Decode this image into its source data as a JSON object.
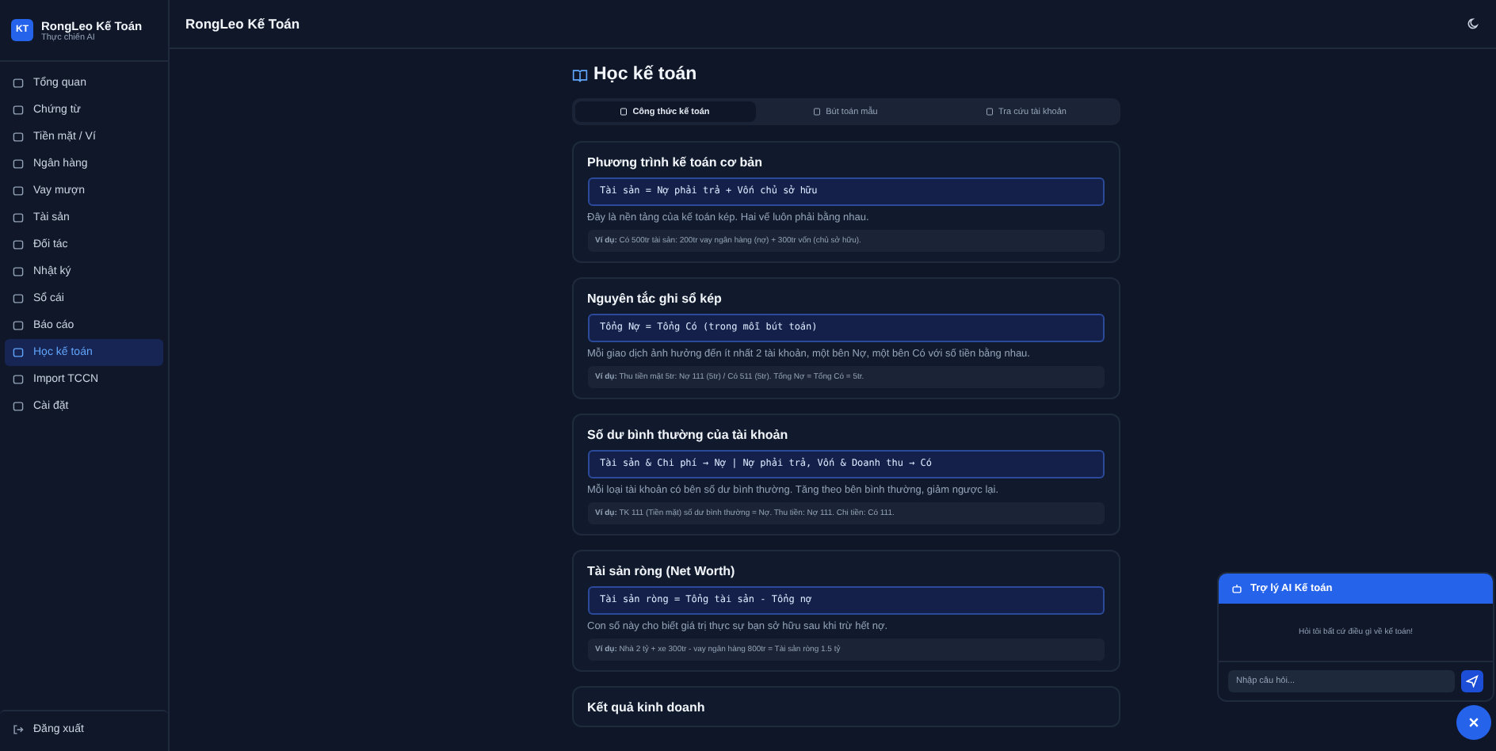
{
  "brand": {
    "logo": "KT",
    "name": "RongLeo Kế Toán",
    "subtitle": "Thực chiến AI"
  },
  "topbar": {
    "title": "RongLeo Kế Toán"
  },
  "sidebar": {
    "items": [
      {
        "label": "Tổng quan",
        "selected": false
      },
      {
        "label": "Chứng từ",
        "selected": false
      },
      {
        "label": "Tiền mặt / Ví",
        "selected": false
      },
      {
        "label": "Ngân hàng",
        "selected": false
      },
      {
        "label": "Vay mượn",
        "selected": false
      },
      {
        "label": "Tài sản",
        "selected": false
      },
      {
        "label": "Đối tác",
        "selected": false
      },
      {
        "label": "Nhật ký",
        "selected": false
      },
      {
        "label": "Sổ cái",
        "selected": false
      },
      {
        "label": "Báo cáo",
        "selected": false
      },
      {
        "label": "Học kế toán",
        "selected": true
      },
      {
        "label": "Import TCCN",
        "selected": false
      },
      {
        "label": "Cài đặt",
        "selected": false
      }
    ],
    "logout": "Đăng xuất"
  },
  "page": {
    "title": "Học kế toán",
    "tabs": [
      {
        "label": "Công thức kế toán",
        "selected": true
      },
      {
        "label": "Bút toán mẫu",
        "selected": false
      },
      {
        "label": "Tra cứu tài khoản",
        "selected": false
      }
    ],
    "cards": [
      {
        "title": "Phương trình kế toán cơ bản",
        "formula": "Tài sản = Nợ phải trả + Vốn chủ sở hữu",
        "description": "Đây là nền tảng của kế toán kép. Hai vế luôn phải bằng nhau.",
        "example": "**Ví dụ:** Có 500tr tài sản: 200tr vay ngân hàng (nợ) + 300tr vốn (chủ sở hữu)."
      },
      {
        "title": "Nguyên tắc ghi sổ kép",
        "formula": "Tổng Nợ = Tổng Có (trong mỗi bút toán)",
        "description": "Mỗi giao dịch ảnh hưởng đến ít nhất 2 tài khoản, một bên Nợ, một bên Có với số tiền bằng nhau.",
        "example": "**Ví dụ:** Thu tiền mặt 5tr: Nợ 111 (5tr) / Có 511 (5tr). Tổng Nợ = Tổng Có = 5tr."
      },
      {
        "title": "Số dư bình thường của tài khoản",
        "formula": "Tài sản & Chi phí → Nợ | Nợ phải trả, Vốn & Doanh thu → Có",
        "description": "Mỗi loại tài khoản có bên số dư bình thường. Tăng theo bên bình thường, giảm ngược lại.",
        "example": "**Ví dụ:** TK 111 (Tiền mặt) số dư bình thường = Nợ. Thu tiền: Nợ 111. Chi tiền: Có 111."
      },
      {
        "title": "Tài sản ròng (Net Worth)",
        "formula": "Tài sản ròng = Tổng tài sản - Tổng nợ",
        "description": "Con số này cho biết giá trị thực sự bạn sở hữu sau khi trừ hết nợ.",
        "example": "**Ví dụ:** Nhà 2 tỷ + xe 300tr - vay ngân hàng 800tr = Tài sản ròng 1.5 tỷ"
      },
      {
        "title": "Kết quả kinh doanh"
      }
    ]
  },
  "chat": {
    "title": "Trợ lý AI Kế toán",
    "message": "Hỏi tôi bất cứ điều gì về kế toán!",
    "placeholder": "Nhập câu hỏi..."
  }
}
